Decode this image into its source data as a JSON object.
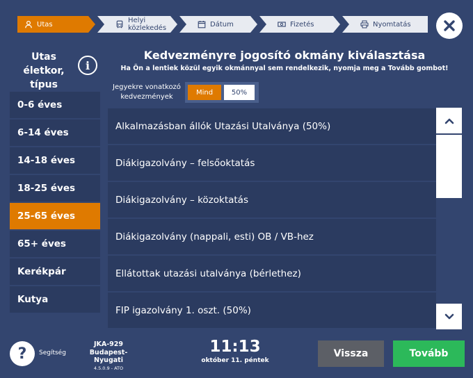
{
  "steps": [
    {
      "label": "Utas",
      "icon": "person-icon",
      "active": true
    },
    {
      "label": "Helyi közlekedés",
      "icon": "bus-icon",
      "active": false
    },
    {
      "label": "Dátum",
      "icon": "calendar-icon",
      "active": false
    },
    {
      "label": "Fizetés",
      "icon": "money-icon",
      "active": false
    },
    {
      "label": "Nyomtatás",
      "icon": "printer-icon",
      "active": false
    }
  ],
  "close_icon": "close-icon",
  "sidebar": {
    "title": "Utas életkor, típus",
    "info_icon": "info-icon",
    "info_glyph": "i",
    "items": [
      {
        "label": "0-6 éves",
        "active": false
      },
      {
        "label": "6-14 éves",
        "active": false
      },
      {
        "label": "14-18 éves",
        "active": false
      },
      {
        "label": "18-25 éves",
        "active": false
      },
      {
        "label": "25-65 éves",
        "active": true
      },
      {
        "label": "65+  éves",
        "active": false
      },
      {
        "label": "Kerékpár",
        "active": false
      },
      {
        "label": "Kutya",
        "active": false
      }
    ]
  },
  "main": {
    "title": "Kedvezményre jogosító okmány kiválasztása",
    "subtitle": "Ha Ön a lentiek közül egyik okmánnyal sem rendelkezik, nyomja meg a Tovább gombot!",
    "filter_label": "Jegyekre vonatkozó kedvezmények",
    "filter_options": [
      "Mind",
      "50%"
    ],
    "filter_selected": "Mind",
    "documents": [
      "Alkalmazásban állók Utazási Utalványa (50%)",
      "Diákigazolvány – felsőoktatás",
      "Diákigazolvány – közoktatás",
      "Diákigazolvány (nappali, esti) OB / VB-hez",
      "Ellátottak utazási utalványa (bérlethez)",
      "FIP igazolvány 1. oszt. (50%)"
    ]
  },
  "footer": {
    "help_glyph": "?",
    "help_label": "Segítség",
    "station_code": "JKA-929",
    "station_name": "Budapest-Nyugati",
    "version": "4.5.0.9 - ATO",
    "time": "11:13",
    "date": "október 11. péntek",
    "back_label": "Vissza",
    "next_label": "Tovább"
  },
  "colors": {
    "background": "#33456f",
    "accent": "#df7a00",
    "list_item": "#2b3b60",
    "next_button": "#2cb95a",
    "back_button": "#5c5f66"
  }
}
